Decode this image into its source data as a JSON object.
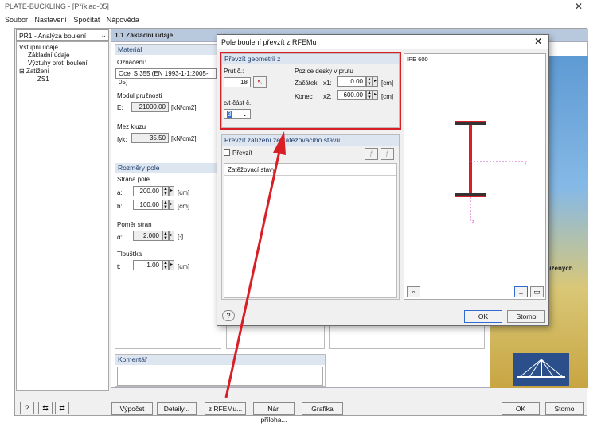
{
  "window": {
    "title": "PLATE-BUCKLING - [Příklad-05]",
    "close": "✕"
  },
  "menu": [
    "Soubor",
    "Nastavení",
    "Spočítat",
    "Nápověda"
  ],
  "nav": {
    "selected": "PŘ1 - Analýza boulení",
    "tree": [
      "Vstupní údaje",
      "Základní údaje",
      "Výztuhy proti boulení",
      "Zatížení",
      "ZS1"
    ]
  },
  "panel": {
    "header": "1.1 Základní údaje",
    "material": {
      "title": "Materiál",
      "designation_label": "Označení:",
      "designation_value": "Ocel S 355 (EN 1993-1-1:2005-05)",
      "modulus_label": "Modul pružnosti",
      "e_label": "E:",
      "e_value": "21000.00",
      "e_unit": "[kN/cm2]",
      "yield_label": "Mez kluzu",
      "fy_label": "fyk:",
      "fy_value": "35.50",
      "fy_unit": "[kN/cm2]"
    },
    "dimensions": {
      "title": "Rozměry pole",
      "side_label": "Strana pole",
      "a_label": "a:",
      "a_value": "200.00",
      "a_unit": "[cm]",
      "b_label": "b:",
      "b_value": "100.00",
      "b_unit": "[cm]",
      "ratio_label": "Poměr stran",
      "alpha_label": "α:",
      "alpha_value": "2.000",
      "alpha_unit": "[-]",
      "thickness_label": "Tloušťka",
      "t_label": "t:",
      "t_value": "1.00",
      "t_unit": "[cm]"
    },
    "comment_title": "Komentář",
    "side_text": "ztužených"
  },
  "buttons": {
    "calc": "Výpočet",
    "details": "Detaily...",
    "from_rfem": "z RFEMu...",
    "nat_annex": "Nár. příloha...",
    "graphics": "Grafika",
    "ok": "OK",
    "cancel": "Storno"
  },
  "dialog": {
    "title": "Pole boulení převzít z RFEMu",
    "close": "✕",
    "geometry": {
      "title": "Převzít geometrii z",
      "member_label": "Prut č.:",
      "member_value": "18",
      "ct_label": "c/t-část č.:",
      "ct_value": "3",
      "position_label": "Pozice desky v prutu",
      "start_label": "Začátek",
      "x1_label": "x1:",
      "x1_value": "0.00",
      "x1_unit": "[cm]",
      "end_label": "Konec",
      "x2_label": "x2:",
      "x2_value": "600.00",
      "x2_unit": "[cm]"
    },
    "loads": {
      "title": "Převzít zatížení ze zatěžovacího stavu",
      "checkbox_label": "Převzít",
      "column_header": "Zatěžovací stavy"
    },
    "preview_title": "IPE 600",
    "ok": "OK",
    "cancel": "Storno"
  },
  "colors": {
    "highlight": "#d81f26",
    "arrow": "#d81f26",
    "accent": "#1f3d6b"
  }
}
